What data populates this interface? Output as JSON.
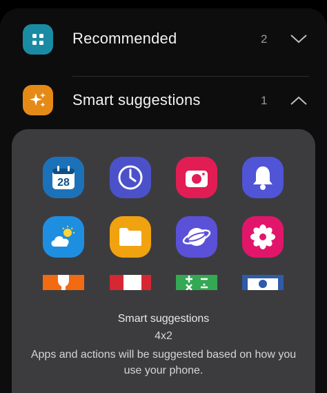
{
  "categories": [
    {
      "label": "Recommended",
      "count": "2",
      "expanded": false,
      "icon": "apps-grid-icon",
      "color": "#1a8ba3"
    },
    {
      "label": "Smart suggestions",
      "count": "1",
      "expanded": true,
      "icon": "sparkle-icon",
      "color": "#e58a16"
    }
  ],
  "widget_preview": {
    "apps": [
      {
        "icon": "calendar-icon",
        "text": "28",
        "color": "#1c72b8"
      },
      {
        "icon": "clock-icon",
        "color": "#4b52c9"
      },
      {
        "icon": "camera-icon",
        "color": "#e11d53"
      },
      {
        "icon": "bell-icon",
        "color": "#4f55d6"
      },
      {
        "icon": "weather-icon",
        "color": "#1e8fe0"
      },
      {
        "icon": "folder-icon",
        "color": "#f1a20f"
      },
      {
        "icon": "internet-icon",
        "color": "#5a51d8"
      },
      {
        "icon": "gallery-icon",
        "color": "#e1166a"
      },
      {
        "icon": "bixby-icon",
        "color": "#f26a12"
      },
      {
        "icon": "store-icon",
        "color": "#d52833"
      },
      {
        "icon": "calculator-icon",
        "color": "#34a853"
      },
      {
        "icon": "settings-icon",
        "color": "#2f5ba8"
      }
    ]
  },
  "info": {
    "title": "Smart suggestions",
    "size": "4x2",
    "description": "Apps and actions will be suggested based on how you use your phone."
  }
}
